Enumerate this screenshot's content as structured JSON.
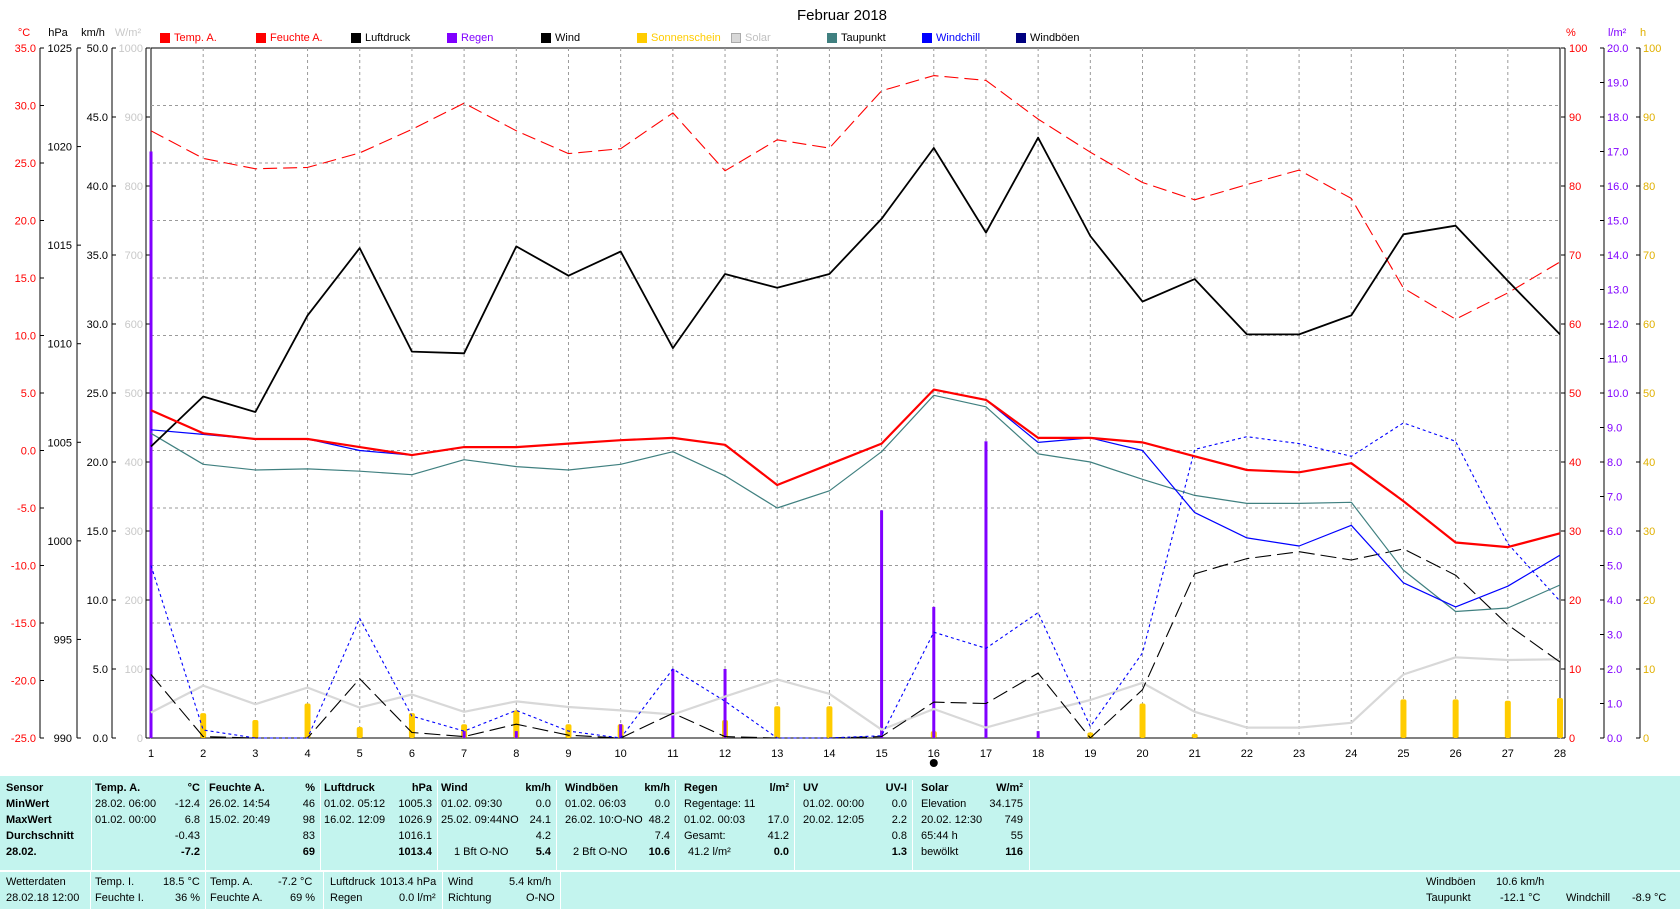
{
  "chart_data": {
    "type": "line",
    "title": "Februar 2018",
    "x": [
      1,
      2,
      3,
      4,
      5,
      6,
      7,
      8,
      9,
      10,
      11,
      12,
      13,
      14,
      15,
      16,
      17,
      18,
      19,
      20,
      21,
      22,
      23,
      24,
      25,
      26,
      27,
      28
    ],
    "left_axes": [
      {
        "label": "°C",
        "min": -25,
        "max": 35,
        "ticks": [
          "35.0",
          "30.0",
          "25.0",
          "20.0",
          "15.0",
          "10.0",
          "5.0",
          "0.0",
          "-5.0",
          "-10.0",
          "-15.0",
          "-20.0",
          "-25.0"
        ]
      },
      {
        "label": "hPa",
        "min": 990,
        "max": 1030,
        "ticks": [
          "1025",
          "1020",
          "1015",
          "1010",
          "1005",
          "1000",
          "995",
          "990"
        ]
      },
      {
        "label": "km/h",
        "min": 0,
        "max": 50,
        "ticks": [
          "50.0",
          "45.0",
          "40.0",
          "35.0",
          "30.0",
          "25.0",
          "20.0",
          "15.0",
          "10.0",
          "5.0",
          "0.0"
        ]
      },
      {
        "label": "W/m²",
        "min": 0,
        "max": 1000,
        "ticks": [
          "1000",
          "900",
          "800",
          "700",
          "600",
          "500",
          "400",
          "300",
          "200",
          "100",
          "0"
        ]
      }
    ],
    "right_axes": [
      {
        "label": "%",
        "min": 0,
        "max": 100,
        "ticks": [
          "100",
          "90",
          "80",
          "70",
          "60",
          "50",
          "40",
          "30",
          "20",
          "10",
          "0"
        ]
      },
      {
        "label": "l/m²",
        "min": 0,
        "max": 20,
        "ticks": [
          "20.0",
          "19.0",
          "18.0",
          "17.0",
          "16.0",
          "15.0",
          "14.0",
          "13.0",
          "12.0",
          "11.0",
          "10.0",
          "9.0",
          "8.0",
          "7.0",
          "6.0",
          "5.0",
          "4.0",
          "3.0",
          "2.0",
          "1.0",
          "0.0"
        ]
      },
      {
        "label": "h",
        "min": 0,
        "max": 100,
        "ticks": [
          "100",
          "90",
          "80",
          "70",
          "60",
          "50",
          "40",
          "30",
          "20",
          "10",
          "0"
        ]
      }
    ],
    "legend": [
      {
        "name": "Temp. A.",
        "color": "#ff0000",
        "label_color": "#ff0000"
      },
      {
        "name": "Feuchte A.",
        "color": "#ff0000",
        "label_color": "#ff0000"
      },
      {
        "name": "Luftdruck",
        "color": "#000000",
        "label_color": "#000000"
      },
      {
        "name": "Regen",
        "color": "#8000ff",
        "label_color": "#8000ff"
      },
      {
        "name": "Wind",
        "color": "#000000",
        "label_color": "#000000"
      },
      {
        "name": "Sonnenschein",
        "color": "#ffcc00",
        "label_color": "#ffcc00"
      },
      {
        "name": "Solar",
        "color": "#d8d8d8",
        "label_color": "#c0c0c0"
      },
      {
        "name": "Taupunkt",
        "color": "#408080",
        "label_color": "#000000"
      },
      {
        "name": "Windchill",
        "color": "#0000ff",
        "label_color": "#0000ff"
      },
      {
        "name": "Windböen",
        "color": "#000080",
        "label_color": "#000000"
      }
    ],
    "series": [
      {
        "name": "Temp. A.",
        "axis": "°C",
        "color": "#ff0000",
        "style": "solid-thick",
        "values": [
          3.5,
          1.5,
          1.0,
          1.0,
          0.3,
          -0.4,
          0.3,
          0.3,
          0.6,
          0.9,
          1.1,
          0.5,
          -3.0,
          -1.2,
          0.6,
          5.3,
          4.4,
          1.1,
          1.1,
          0.7,
          -0.5,
          -1.7,
          -1.9,
          -1.1,
          -4.4,
          -8.0,
          -8.4,
          -7.2
        ]
      },
      {
        "name": "Feuchte A.",
        "axis": "%",
        "color": "#ff0000",
        "style": "dashed",
        "values": [
          88,
          84,
          82.5,
          82.7,
          84.8,
          88.2,
          92,
          88,
          84.7,
          85.4,
          90.6,
          82.2,
          86.7,
          85.5,
          93.8,
          96,
          95.3,
          89.7,
          84.9,
          80.5,
          78,
          80.2,
          82.3,
          78.2,
          65.2,
          60.7,
          64.5,
          69
        ]
      },
      {
        "name": "Luftdruck",
        "axis": "hPa",
        "color": "#000000",
        "style": "solid",
        "values": [
          1006.9,
          1009.8,
          1008.9,
          1014.5,
          1018.4,
          1012.4,
          1012.3,
          1018.5,
          1016.8,
          1018.2,
          1012.6,
          1016.9,
          1016.1,
          1016.9,
          1020.1,
          1024.2,
          1019.3,
          1024.8,
          1019.1,
          1015.3,
          1016.6,
          1013.4,
          1013.4,
          1014.5,
          1019.2,
          1019.7,
          1016.5,
          1013.4
        ]
      },
      {
        "name": "Taupunkt",
        "axis": "°C",
        "color": "#408080",
        "style": "solid-thin",
        "values": [
          1.5,
          -1.2,
          -1.7,
          -1.6,
          -1.8,
          -2.1,
          -0.8,
          -1.4,
          -1.7,
          -1.2,
          -0.1,
          -2.2,
          -5.0,
          -3.5,
          -0.1,
          4.8,
          3.8,
          -0.3,
          -1.0,
          -2.5,
          -3.9,
          -4.6,
          -4.6,
          -4.5,
          -10.4,
          -14.0,
          -13.7,
          -11.7
        ]
      },
      {
        "name": "Windchill",
        "axis": "°C",
        "color": "#0000ff",
        "style": "solid-thin",
        "values": [
          1.8,
          1.4,
          1.0,
          1.0,
          0.0,
          -0.4,
          0.3,
          0.3,
          0.6,
          0.9,
          1.1,
          0.5,
          -3.0,
          -1.2,
          0.6,
          5.3,
          4.4,
          0.7,
          1.1,
          0.0,
          -5.4,
          -7.6,
          -8.3,
          -6.5,
          -11.5,
          -13.6,
          -11.8,
          -9.1
        ]
      },
      {
        "name": "Windchill (Minimum)",
        "axis": "°C",
        "color": "#0000ff",
        "style": "dotted",
        "values": [
          -10.0,
          -24.3,
          -25.0,
          -25.0,
          -14.6,
          -23.1,
          -24.4,
          -22.6,
          -24.4,
          -25.0,
          -19.0,
          -21.8,
          -25.0,
          -25.0,
          -24.8,
          -15.8,
          -17.2,
          -14.1,
          -24.0,
          -17.6,
          0.1,
          1.2,
          0.6,
          -0.5,
          2.4,
          0.8,
          -8.1,
          -13.1
        ]
      },
      {
        "name": "Wind",
        "axis": "km/h",
        "color": "#000000",
        "style": "dashed-long",
        "values": [
          4.6,
          0.1,
          0.0,
          0.0,
          4.3,
          0.4,
          0.1,
          1.0,
          0.2,
          0.0,
          1.8,
          0.1,
          0.0,
          0.0,
          0.1,
          2.6,
          2.5,
          4.7,
          0.0,
          3.5,
          11.9,
          13.0,
          13.5,
          12.9,
          13.7,
          11.8,
          8.2,
          5.5
        ]
      },
      {
        "name": "Solar",
        "axis": "W/m²",
        "color": "#d8d8d8",
        "style": "solid-thick",
        "values": [
          37,
          76,
          49,
          73,
          44,
          63,
          38,
          53,
          45,
          40,
          34,
          60,
          85,
          64,
          12,
          42,
          15,
          36,
          55,
          80,
          38,
          15,
          15,
          22,
          92,
          117,
          113,
          114
        ]
      }
    ],
    "rain_bars": {
      "name": "Regen",
      "axis": "l/m²",
      "color": "#8000ff",
      "values": [
        17.0,
        0,
        0,
        0,
        0,
        0,
        0.2,
        0.2,
        0,
        0.4,
        2.0,
        2.0,
        0,
        0,
        6.6,
        3.8,
        8.6,
        0.2,
        0,
        0,
        0,
        0,
        0,
        0,
        0,
        0,
        0,
        0
      ]
    },
    "sun_bars": {
      "name": "Sonnenschein",
      "axis": "h",
      "color": "#ffcc00",
      "values": [
        0,
        3.6,
        2.6,
        5.0,
        1.6,
        3.6,
        2.0,
        4.0,
        2.0,
        2.0,
        0,
        2.6,
        4.6,
        4.6,
        0,
        1.0,
        0,
        0,
        0.8,
        5.0,
        0.6,
        0,
        0,
        0,
        5.6,
        5.6,
        5.4,
        5.8
      ]
    }
  },
  "panel": {
    "row_labels": {
      "sensor": "Sensor",
      "min": "MinWert",
      "max": "MaxWert",
      "avg": "Durchschnitt",
      "date": "28.02."
    },
    "temp": {
      "title": "Temp. A.",
      "unit": "°C",
      "min_time": "28.02.  06:00",
      "min_val": "-12.4",
      "max_time": "01.02.  00:00",
      "max_val": "6.8",
      "avg": "-0.43",
      "current": "-7.2"
    },
    "humidity": {
      "title": "Feuchte A.",
      "unit": "%",
      "min_time": "26.02.  14:54",
      "min_val": "46",
      "max_time": "15.02.  20:49",
      "max_val": "98",
      "avg": "83",
      "current": "69"
    },
    "pressure": {
      "title": "Luftdruck",
      "unit": "hPa",
      "min_time": "01.02.  05:12",
      "min_val": "1005.3",
      "max_time": "16.02.  12:09",
      "max_val": "1026.9",
      "avg": "1016.1",
      "current": "1013.4"
    },
    "wind": {
      "title": "Wind",
      "unit": "km/h",
      "min_time": "01.02.  09:30",
      "min_val": "0.0",
      "max_time": "25.02.  09:44NO",
      "max_val": "24.1",
      "avg": "4.2",
      "current_dir": "1 Bft O-NO",
      "current": "5.4"
    },
    "gusts": {
      "title": "Windböen",
      "unit": "km/h",
      "min_time": "01.02.  06:03",
      "min_val": "0.0",
      "max_time": "26.02.  10:O-NO",
      "max_val": "48.2",
      "avg": "7.4",
      "current_dir": "2 Bft O-NO",
      "current": "10.6"
    },
    "rain": {
      "title": "Regen",
      "unit": "l/m²",
      "days_label": "Regentage: 11",
      "max_time": "01.02.  00:03",
      "max_val": "17.0",
      "total_label": "Gesamt:",
      "total_val": "41.2",
      "current_label": "41.2 l/m²",
      "current": "0.0"
    },
    "uv": {
      "title": "UV",
      "unit": "UV-I",
      "min_time": "01.02.  00:00",
      "min_val": "0.0",
      "max_time": "20.02.  12:05",
      "max_val": "2.2",
      "avg": "0.8",
      "current": "1.3"
    },
    "solar": {
      "title": "Solar",
      "unit": "W/m²",
      "elev_label": "Elevation",
      "elev_val": "34.175",
      "max_time": "20.02.  12:30",
      "max_val": "749",
      "dur_label": "65:44 h",
      "dur_val": "55",
      "current_label": "bewölkt",
      "current": "116"
    }
  },
  "bottom_bar": {
    "label1": "Wetterdaten",
    "datetime": "28.02.18 12:00",
    "temp_i_label": "Temp. I.",
    "temp_i_val": "18.5 °C",
    "hum_i_label": "Feuchte I.",
    "hum_i_val": "36 %",
    "temp_a_label": "Temp. A.",
    "temp_a_val": "-7.2 °C",
    "hum_a_label": "Feuchte A.",
    "hum_a_val": "69 %",
    "press_label": "Luftdruck",
    "press_val": "1013.4 hPa",
    "rain_label": "Regen",
    "rain_val": "0.0 l/m²",
    "wind_label": "Wind",
    "wind_val": "5.4 km/h",
    "dir_label": "Richtung",
    "dir_val": "O-NO",
    "gust_label": "Windböen",
    "gust_val": "10.6 km/h",
    "dew_label": "Taupunkt",
    "dew_val": "-12.1 °C",
    "chill_label": "Windchill",
    "chill_val": "-8.9 °C"
  }
}
